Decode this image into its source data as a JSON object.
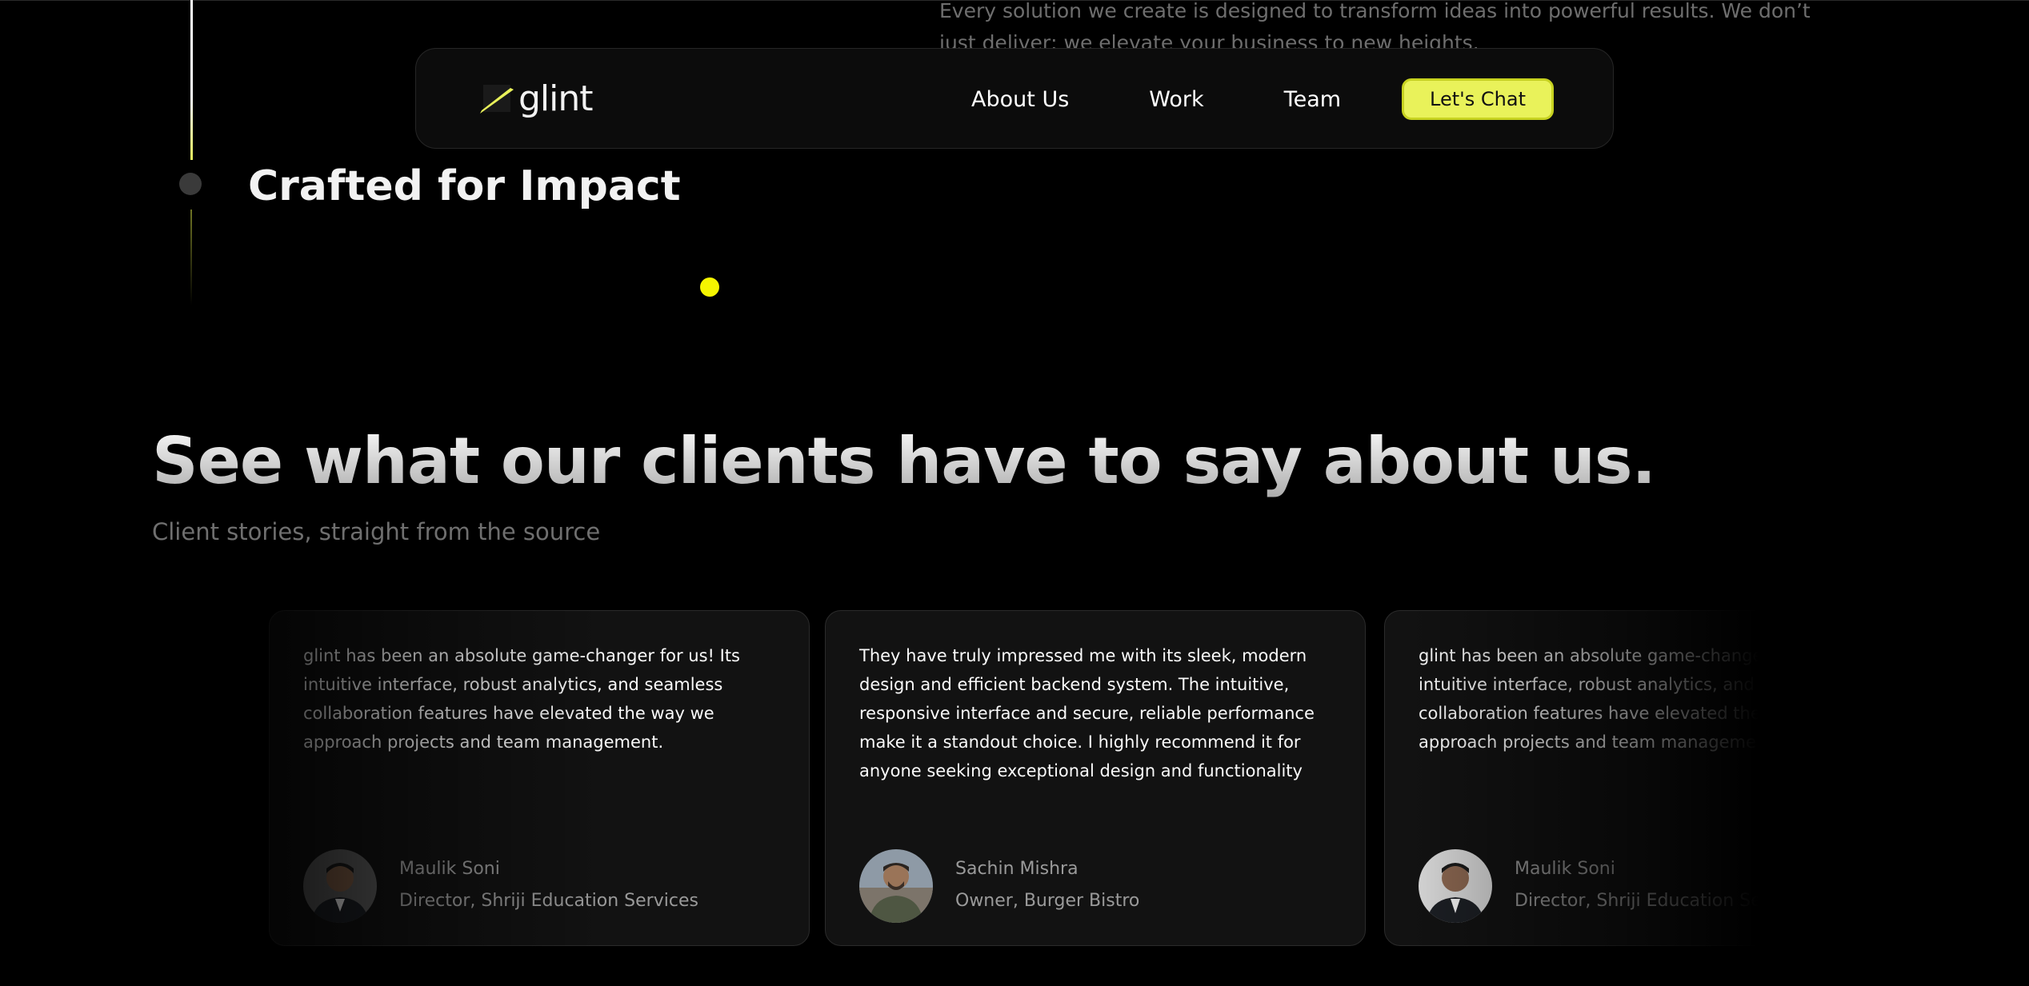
{
  "intro": {
    "text": "Every solution we create is designed to transform ideas into powerful results. We don’t just deliver; we elevate your business to new heights."
  },
  "timeline": {
    "title": "Crafted for Impact"
  },
  "navbar": {
    "logo_text": "glint",
    "links": [
      "About Us",
      "Work",
      "Team"
    ],
    "cta_label": "Let's Chat"
  },
  "testimonials": {
    "title": "See what our clients have to say about us.",
    "subtitle": "Client stories, straight from the source",
    "cards": [
      {
        "quote": "glint has been an absolute game-changer for us! Its intuitive interface, robust analytics, and seamless collaboration features have elevated the way we approach projects and team management.",
        "name": "Maulik Soni",
        "role": "Director, Shriji Education Services"
      },
      {
        "quote": "They have truly impressed me with its sleek, modern design and efficient backend system. The intuitive, responsive interface and secure, reliable performance make it a standout choice. I highly recommend it for anyone seeking exceptional design and functionality",
        "name": "Sachin Mishra",
        "role": "Owner, Burger Bistro"
      },
      {
        "quote": "glint has been an absolute game-changer for us! Its intuitive interface, robust analytics, and seamless collaboration features have elevated the way we approach projects and team management.",
        "name": "Maulik Soni",
        "role": "Director, Shriji Education Services"
      }
    ]
  },
  "colors": {
    "accent": "#e9f25a",
    "background": "#000000",
    "card": "#121212"
  }
}
